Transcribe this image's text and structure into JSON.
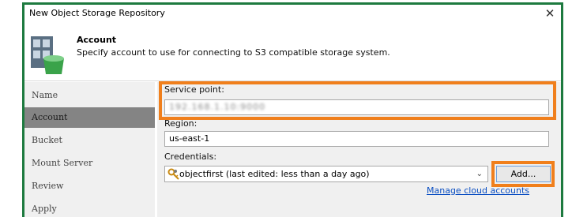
{
  "window": {
    "title": "New Object Storage Repository",
    "close_glyph": "✕"
  },
  "header": {
    "title": "Account",
    "subtitle": "Specify account to use for connecting to S3 compatible storage system.",
    "icon": "object-storage-repository-icon"
  },
  "sidebar": {
    "items": [
      {
        "label": "Name",
        "active": false
      },
      {
        "label": "Account",
        "active": true
      },
      {
        "label": "Bucket",
        "active": false
      },
      {
        "label": "Mount Server",
        "active": false
      },
      {
        "label": "Review",
        "active": false
      },
      {
        "label": "Apply",
        "active": false
      }
    ]
  },
  "form": {
    "service_point": {
      "label": "Service point:",
      "value": "192.168.1.10:9000",
      "obscured": true
    },
    "region": {
      "label": "Region:",
      "value": "us-east-1"
    },
    "credentials": {
      "label": "Credentials:",
      "selected": "objectfirst (last edited: less than a day ago)",
      "icon": "key-icon"
    },
    "add_button": "Add...",
    "manage_link": "Manage cloud accounts"
  },
  "colors": {
    "frame_border": "#1d7a3f",
    "highlight": "#f07f1c",
    "active_nav": "#848484",
    "link": "#0a4ec2"
  }
}
